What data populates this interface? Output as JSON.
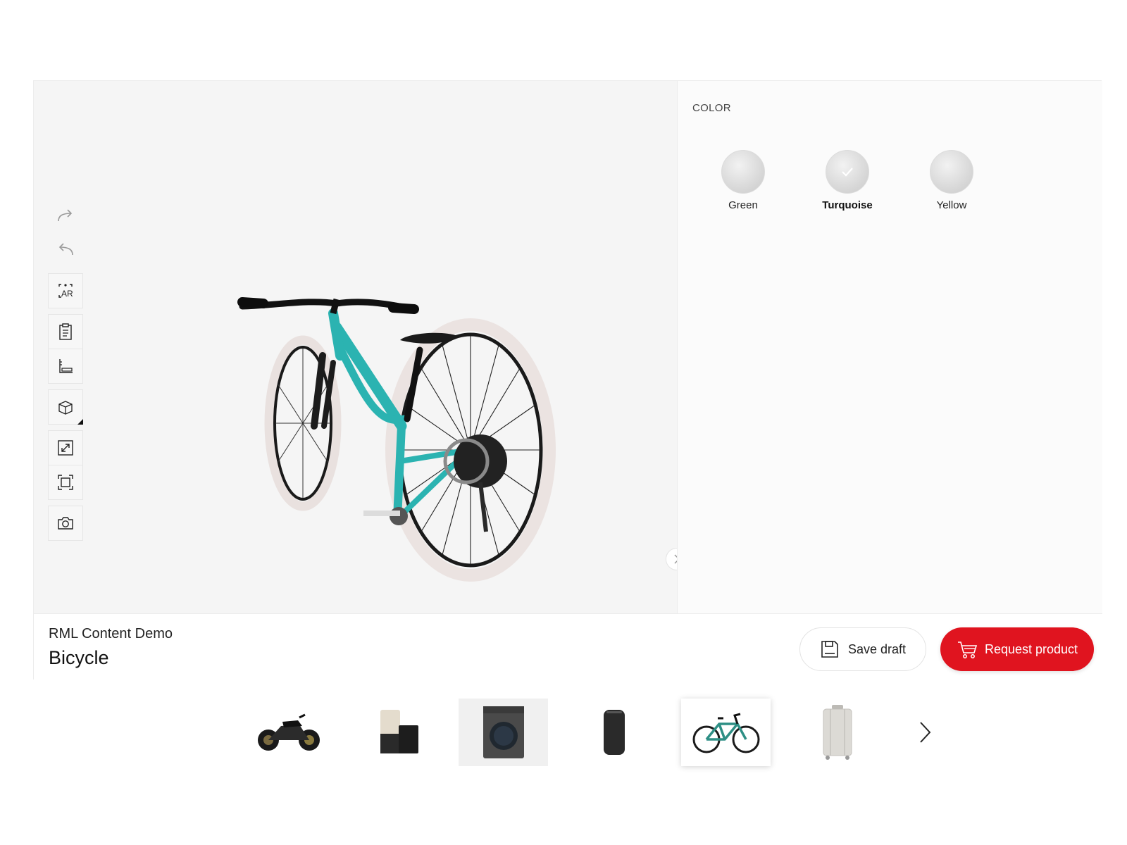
{
  "viewer": {
    "toolbar": {
      "redo": "redo-icon",
      "undo": "undo-icon",
      "ar_label": "AR",
      "tools": [
        "ar-view-icon",
        "clipboard-icon",
        "measure-icon",
        "cube-view-icon",
        "expand-icon",
        "fit-frame-icon",
        "camera-icon"
      ]
    },
    "panel_toggle_icon": "chevron-right-icon"
  },
  "options": {
    "section_title": "COLOR",
    "swatches": [
      {
        "label": "Green",
        "selected": false
      },
      {
        "label": "Turquoise",
        "selected": true
      },
      {
        "label": "Yellow",
        "selected": false
      }
    ]
  },
  "footer": {
    "brand": "RML Content Demo",
    "product_name": "Bicycle",
    "save_label": "Save draft",
    "request_label": "Request product",
    "accent_color": "#e0141f"
  },
  "carousel": {
    "items": [
      {
        "icon": "motorcycle-icon",
        "active": false
      },
      {
        "icon": "coffee-machine-icon",
        "active": false
      },
      {
        "icon": "washing-machine-icon",
        "active": false
      },
      {
        "icon": "speaker-icon",
        "active": false
      },
      {
        "icon": "bicycle-icon",
        "active": true
      },
      {
        "icon": "suitcase-icon",
        "active": false
      }
    ],
    "next_icon": "chevron-right-icon"
  },
  "colors": {
    "frame_turquoise": "#2bb3b1",
    "viewer_bg": "#f5f5f5"
  }
}
